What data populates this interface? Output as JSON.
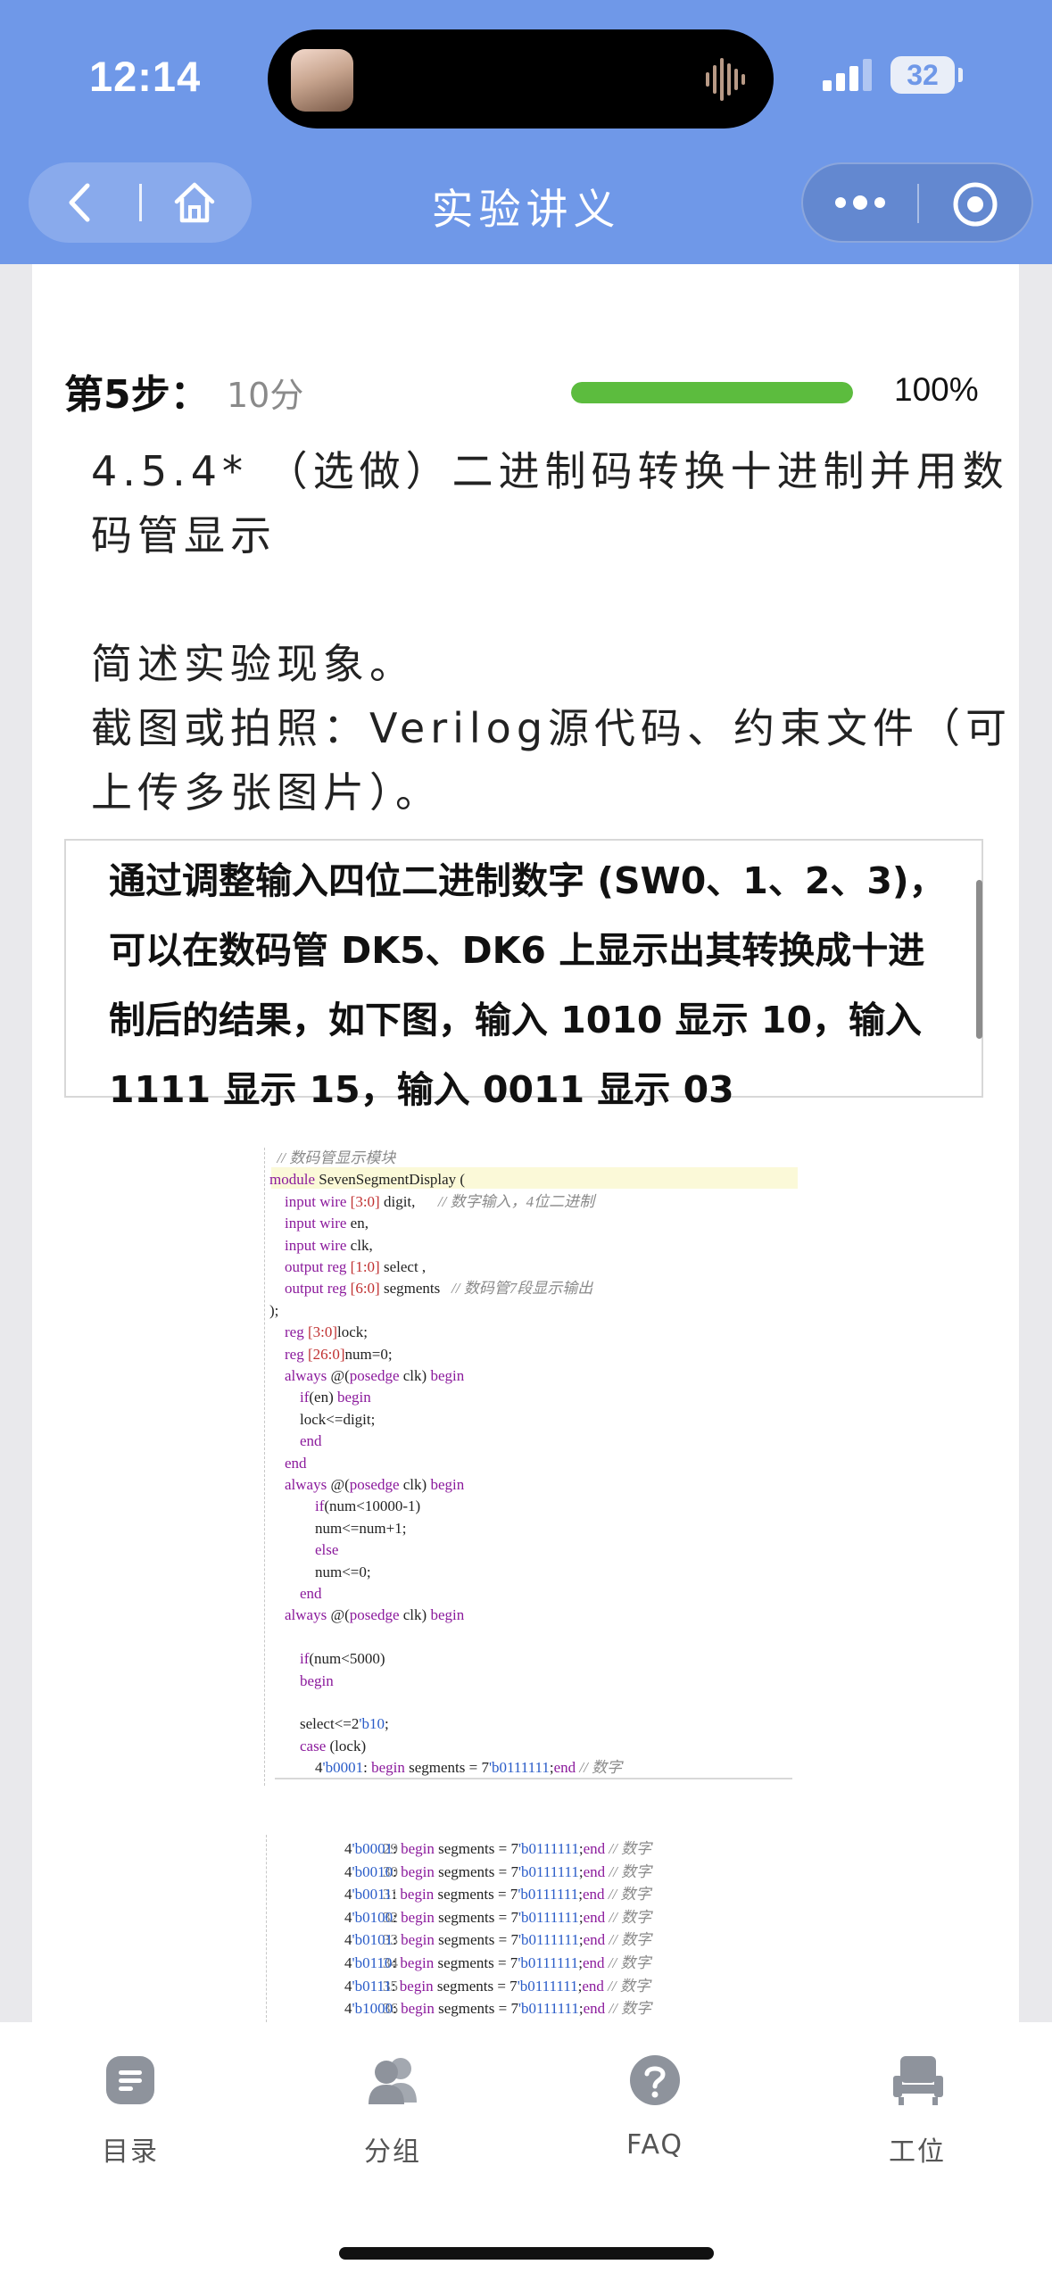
{
  "status_bar": {
    "time": "12:14",
    "battery": "32"
  },
  "nav": {
    "title": "实验讲义"
  },
  "step": {
    "title": "第5步：",
    "score": "10分",
    "progress": 100,
    "progress_label": "100%"
  },
  "question": {
    "heading": "4.5.4* （选做）二进制码转换十进制并用数码管显示",
    "line1": "简述实验现象。",
    "line2": "截图或拍照：Verilog源代码、约束文件（可上传多张图片）。"
  },
  "answer": {
    "text": "通过调整输入四位二进制数字 (SW0、1、2、3)，可以在数码管 DK5、DK6 上显示出其转换成十进制后的结果，如下图，输入 1010 显示 10，输入 1111 显示 15，输入 0011 显示 03"
  },
  "code_image_1": {
    "lines": [
      "  // 数码管显示模块",
      "module SevenSegmentDisplay (",
      "    input wire [3:0] digit,      // 数字输入，4位二进制",
      "    input wire en,",
      "    input wire clk,",
      "    output reg [1:0] select ,",
      "    output reg [6:0] segments   // 数码管7段显示输出",
      ");",
      "    reg [3:0]lock;",
      "    reg [26:0]num=0;",
      "    always @(posedge clk) begin",
      "        if(en) begin",
      "        lock<=digit;",
      "        end",
      "    end",
      "    always @(posedge clk) begin",
      "            if(num<10000-1)",
      "            num<=num+1;",
      "            else",
      "            num<=0;",
      "        end",
      "    always @(posedge clk) begin",
      "",
      "        if(num<5000)",
      "        begin",
      "",
      "        select<=2'b10;",
      "        case (lock)",
      "            4'b0001: begin segments = 7'b0111111;end // 数字"
    ]
  },
  "code_image_2": {
    "line_numbers": [
      "29",
      "30",
      "31",
      "32",
      "33",
      "34",
      "35",
      "36"
    ],
    "lines": [
      "4'b0001: begin segments = 7'b0111111;end // 数字",
      "4'b0010: begin segments = 7'b0111111;end // 数字",
      "4'b0011: begin segments = 7'b0111111;end // 数字",
      "4'b0100: begin segments = 7'b0111111;end // 数字",
      "4'b0101: begin segments = 7'b0111111;end // 数字",
      "4'b0110: begin segments = 7'b0111111;end // 数字",
      "4'b0111: begin segments = 7'b0111111;end // 数字",
      "4'b1000: begin segments = 7'b0111111;end // 数字"
    ]
  },
  "tabbar": {
    "items": [
      {
        "label": "目录",
        "icon": "list-icon"
      },
      {
        "label": "分组",
        "icon": "group-icon"
      },
      {
        "label": "FAQ",
        "icon": "help-icon"
      },
      {
        "label": "工位",
        "icon": "workstation-icon"
      }
    ]
  },
  "colors": {
    "header": "#6f98e8",
    "progress": "#5cbc3e",
    "tab_icon": "#8e939c"
  }
}
